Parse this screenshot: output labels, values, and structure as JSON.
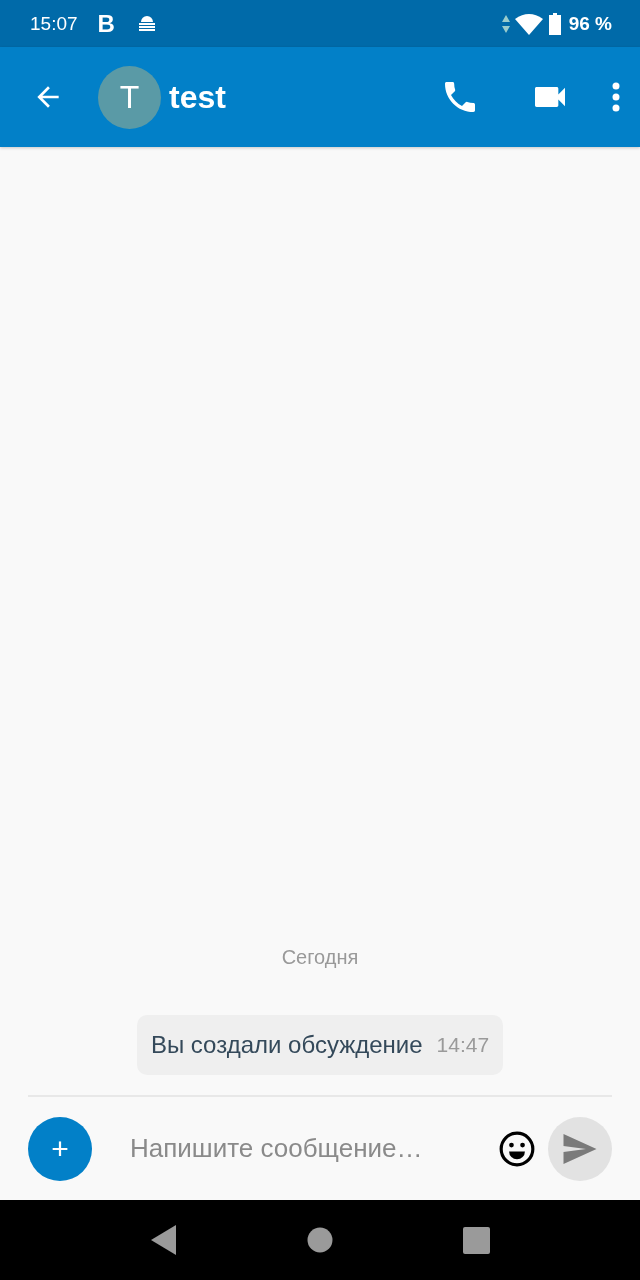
{
  "status_bar": {
    "time": "15:07",
    "notification_letter": "B",
    "battery": "96 %"
  },
  "app_bar": {
    "avatar_letter": "T",
    "title": "test"
  },
  "conversation": {
    "date_divider": "Сегодня",
    "messages": [
      {
        "kind": "system",
        "text": "Вы создали обсуждение",
        "time": "14:47"
      }
    ]
  },
  "composer": {
    "add_symbol": "+",
    "placeholder": "Напишите сообщение…"
  }
}
